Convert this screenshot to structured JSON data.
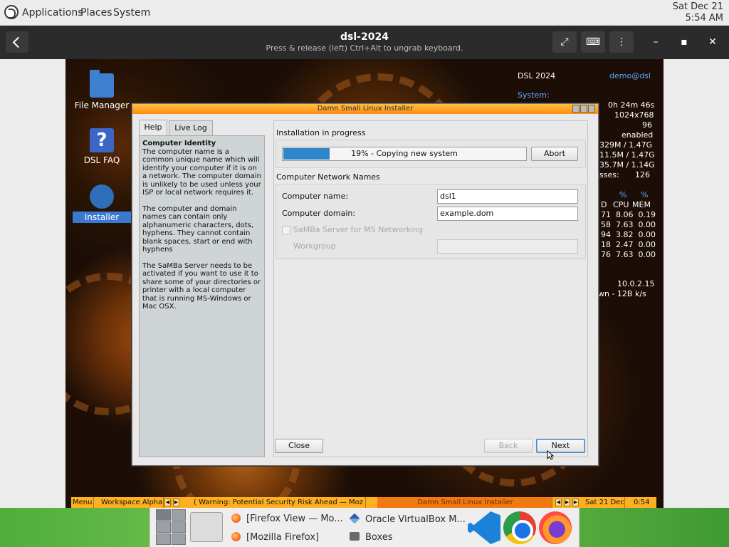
{
  "host_panel": {
    "menus": [
      "Applications",
      "Places",
      "System"
    ],
    "clock_date": "Sat Dec 21",
    "clock_time": "5:54 AM"
  },
  "vm_bar": {
    "title": "dsl-2024",
    "subtitle": "Press & release (left) Ctrl+Alt to ungrab keyboard.",
    "buttons": [
      "back-icon",
      "fullscreen-icon",
      "keyboard-icon",
      "more-vert-icon"
    ],
    "controls": [
      "minimize-icon",
      "maximize-icon",
      "close-icon"
    ]
  },
  "desktop": {
    "icons": [
      {
        "label": "File Manager",
        "icon": "folder-icon"
      },
      {
        "label": "DSL FAQ",
        "icon": "help-icon"
      },
      {
        "label": "Installer",
        "icon": "installer-icon"
      }
    ],
    "conky": {
      "name": "DSL 2024",
      "user": "demo@dsl",
      "system_label": "System:",
      "lines": [
        "0h 24m 46s",
        "1024x768",
        "96",
        "enabled",
        "329M / 1.47G",
        "11.5M / 1.47G",
        "35.7M / 1.14G",
        "sses:",
        "126"
      ],
      "proc_header": [
        "D",
        "%",
        "%",
        "CPU",
        "MEM"
      ],
      "proc_rows": [
        [
          "71",
          "8.06",
          "0.19"
        ],
        [
          "58",
          "7.63",
          "0.00"
        ],
        [
          "94",
          "3.82",
          "0.00"
        ],
        [
          "18",
          "2.47",
          "0.00"
        ],
        [
          "76",
          "7.63",
          "0.00"
        ]
      ],
      "ip": "10.0.2.15",
      "net": "wn - 12B  k/s"
    }
  },
  "installer": {
    "window_title": "Damn Small Linux Installer",
    "tabs": [
      "Help",
      "Live Log"
    ],
    "help": {
      "heading": "Computer Identity",
      "p1": "The computer name is a common unique name which will identify your computer if it is on a network. The computer domain is unlikely to be used unless your ISP or local network requires it.",
      "p2": "The computer and domain names can contain only alphanumeric characters, dots, hyphens. They cannot contain blank spaces, start or end with hyphens",
      "p3": "The SaMBa Server needs to be activated if you want to use it to share some of your directories or printer with a local computer that is running MS-Windows or Mac OSX."
    },
    "progress_section": "Installation in progress",
    "progress_text": "19% - Copying new system",
    "progress_fraction": 0.19,
    "abort_label": "Abort",
    "network_section": "Computer Network Names",
    "computer_name_label": "Computer name:",
    "computer_name_value": "dsl1",
    "computer_domain_label": "Computer domain:",
    "computer_domain_value": "example.dom",
    "samba_label": "SaMBa Server for MS Networking",
    "workgroup_label": "Workgroup",
    "workgroup_value": "",
    "close_label": "Close",
    "back_label": "Back",
    "next_label": "Next"
  },
  "guest_taskbar": {
    "menu": "Menu",
    "workspace": "Workspace Alpha",
    "task1": "( Warning: Potential Security Risk Ahead — Moz",
    "task2": "Damn Small Linux Installer",
    "date": "Sat 21 Dec",
    "time": "0:54"
  },
  "host_dock": {
    "items": [
      {
        "label": "[Firefox View — Mo...",
        "icon": "firefox-icon"
      },
      {
        "label": "[Mozilla Firefox]",
        "icon": "firefox-icon"
      },
      {
        "label": "Oracle VirtualBox M...",
        "icon": "virtualbox-icon"
      },
      {
        "label": "Boxes",
        "icon": "boxes-icon"
      }
    ],
    "apps": [
      "vscode-icon",
      "chrome-icon",
      "firefox-icon"
    ]
  }
}
